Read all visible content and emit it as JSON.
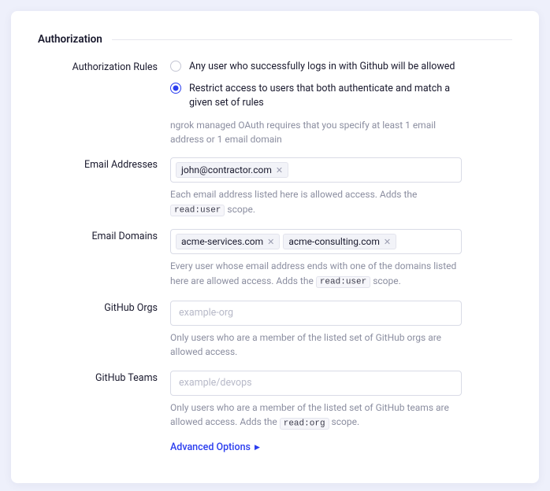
{
  "section": {
    "title": "Authorization"
  },
  "rules": {
    "label": "Authorization Rules",
    "opt1": "Any user who successfully logs in with Github will be allowed",
    "opt2": "Restrict access to users that both authenticate and match a given set of rules",
    "note": "ngrok managed OAuth requires that you specify at least 1 email address or 1 email domain"
  },
  "emails": {
    "label": "Email Addresses",
    "tags": [
      "john@contractor.com"
    ],
    "help_a": "Each email address listed here is allowed access. Adds the ",
    "scope": "read:user",
    "help_b": " scope."
  },
  "domains": {
    "label": "Email Domains",
    "tags": [
      "acme-services.com",
      "acme-consulting.com"
    ],
    "help_a": "Every user whose email address ends with one of the domains listed here are allowed access. Adds the ",
    "scope": "read:user",
    "help_b": " scope."
  },
  "orgs": {
    "label": "GitHub Orgs",
    "placeholder": "example-org",
    "help": "Only users who are a member of the listed set of GitHub orgs are allowed access."
  },
  "teams": {
    "label": "GitHub Teams",
    "placeholder": "example/devops",
    "help_a": "Only users who are a member of the listed set of GitHub teams are allowed access. Adds the ",
    "scope": "read:org",
    "help_b": " scope."
  },
  "advanced": {
    "label": "Advanced Options"
  }
}
